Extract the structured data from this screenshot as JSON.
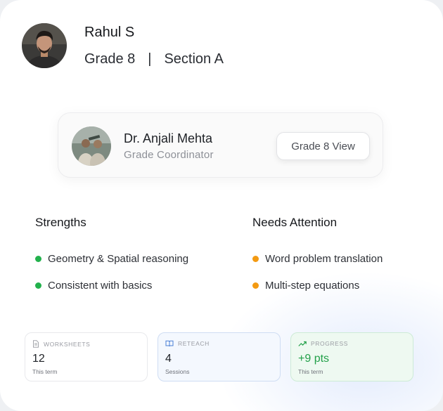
{
  "student": {
    "name": "Rahul S",
    "grade": "Grade 8",
    "separator": "|",
    "section": "Section A"
  },
  "coordinator": {
    "name": "Dr. Anjali Mehta",
    "role": "Grade Coordinator",
    "button_label": "Grade 8 View"
  },
  "strengths": {
    "title": "Strengths",
    "dot_color": "#22b14c",
    "items": [
      "Geometry & Spatial reasoning",
      "Consistent with basics"
    ]
  },
  "needs_attention": {
    "title": "Needs Attention",
    "dot_color": "#f39a12",
    "items": [
      "Word problem translation",
      "Multi-step equations"
    ]
  },
  "stats": [
    {
      "label": "WORKSHEETS",
      "icon": "document-icon",
      "value": "12",
      "sub": "This term"
    },
    {
      "label": "RETEACH",
      "icon": "book-icon",
      "value": "4",
      "sub": "Sessions"
    },
    {
      "label": "PROGRESS",
      "icon": "trend-up-icon",
      "value": "+9 pts",
      "sub": "This term"
    }
  ]
}
